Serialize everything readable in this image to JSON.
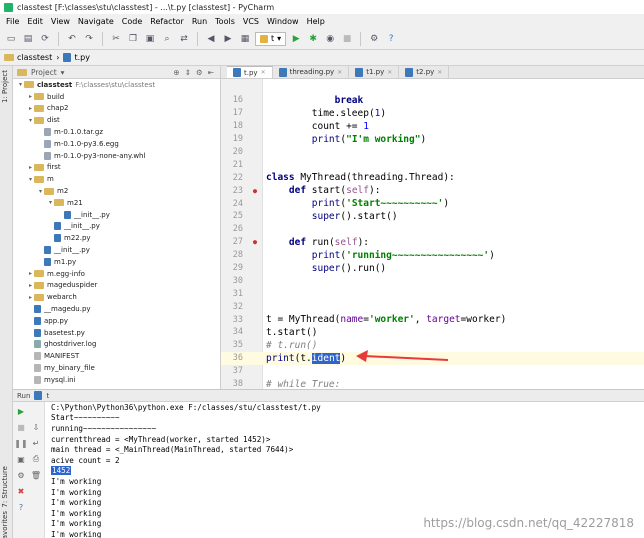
{
  "window": {
    "title": "classtest [F:\\classes\\stu\\classtest] - ...\\t.py [classtest] - PyCharm"
  },
  "menu": [
    "File",
    "Edit",
    "View",
    "Navigate",
    "Code",
    "Refactor",
    "Run",
    "Tools",
    "VCS",
    "Window",
    "Help"
  ],
  "toolbar": {
    "run_config": "t"
  },
  "breadcrumb": {
    "project": "classtest",
    "file": "t.py"
  },
  "project_panel": {
    "title": "Project",
    "root": {
      "name": "classtest",
      "path": "F:\\classes\\stu\\classtest"
    },
    "items": [
      {
        "label": "build",
        "type": "folder",
        "depth": 1,
        "arrow": "▸"
      },
      {
        "label": "chap2",
        "type": "folder",
        "depth": 1,
        "arrow": "▸"
      },
      {
        "label": "dist",
        "type": "folder",
        "depth": 1,
        "arrow": "▾"
      },
      {
        "label": "m-0.1.0.tar.gz",
        "type": "file",
        "depth": 2,
        "arrow": ""
      },
      {
        "label": "m-0.1.0-py3.6.egg",
        "type": "file",
        "depth": 2,
        "arrow": ""
      },
      {
        "label": "m-0.1.0-py3-none-any.whl",
        "type": "file",
        "depth": 2,
        "arrow": ""
      },
      {
        "label": "first",
        "type": "folder",
        "depth": 1,
        "arrow": "▸"
      },
      {
        "label": "m",
        "type": "folder",
        "depth": 1,
        "arrow": "▾"
      },
      {
        "label": "m2",
        "type": "folder",
        "depth": 2,
        "arrow": "▾"
      },
      {
        "label": "m21",
        "type": "folder",
        "depth": 3,
        "arrow": "▾"
      },
      {
        "label": "__init__.py",
        "type": "py",
        "depth": 4,
        "arrow": ""
      },
      {
        "label": "__init__.py",
        "type": "py",
        "depth": 3,
        "arrow": ""
      },
      {
        "label": "m22.py",
        "type": "py",
        "depth": 3,
        "arrow": ""
      },
      {
        "label": "__init__.py",
        "type": "py",
        "depth": 2,
        "arrow": ""
      },
      {
        "label": "m1.py",
        "type": "py",
        "depth": 2,
        "arrow": ""
      },
      {
        "label": "m.egg-info",
        "type": "folder",
        "depth": 1,
        "arrow": "▸"
      },
      {
        "label": "mageduspider",
        "type": "folder",
        "depth": 1,
        "arrow": "▸"
      },
      {
        "label": "webarch",
        "type": "folder",
        "depth": 1,
        "arrow": "▸"
      },
      {
        "label": "__magedu.py",
        "type": "py",
        "depth": 1,
        "arrow": ""
      },
      {
        "label": "app.py",
        "type": "py",
        "depth": 1,
        "arrow": ""
      },
      {
        "label": "basetest.py",
        "type": "py",
        "depth": 1,
        "arrow": ""
      },
      {
        "label": "ghostdriver.log",
        "type": "log",
        "depth": 1,
        "arrow": ""
      },
      {
        "label": "MANIFEST",
        "type": "txt",
        "depth": 1,
        "arrow": ""
      },
      {
        "label": "my_binary_file",
        "type": "txt",
        "depth": 1,
        "arrow": ""
      },
      {
        "label": "mysql.ini",
        "type": "txt",
        "depth": 1,
        "arrow": ""
      }
    ]
  },
  "tabs": [
    {
      "label": "t.py",
      "active": true
    },
    {
      "label": "threading.py",
      "active": false
    },
    {
      "label": "t1.py",
      "active": false
    },
    {
      "label": "t2.py",
      "active": false
    }
  ],
  "editor": {
    "lines": [
      {
        "n": "16",
        "text": "            break"
      },
      {
        "n": "17",
        "text": "        time.sleep(1)"
      },
      {
        "n": "18",
        "text": "        count += 1"
      },
      {
        "n": "19",
        "text": "        print(\"I'm working\")"
      },
      {
        "n": "20",
        "text": ""
      },
      {
        "n": "21",
        "text": ""
      },
      {
        "n": "22",
        "text": "class MyThread(threading.Thread):"
      },
      {
        "n": "23",
        "text": "    def start(self):"
      },
      {
        "n": "24",
        "text": "        print('Start~~~~~~~~~~')"
      },
      {
        "n": "25",
        "text": "        super().start()"
      },
      {
        "n": "26",
        "text": ""
      },
      {
        "n": "27",
        "text": "    def run(self):"
      },
      {
        "n": "28",
        "text": "        print('running~~~~~~~~~~~~~~~~')"
      },
      {
        "n": "29",
        "text": "        super().run()"
      },
      {
        "n": "30",
        "text": ""
      },
      {
        "n": "31",
        "text": ""
      },
      {
        "n": "32",
        "text": ""
      },
      {
        "n": "33",
        "text": "t = MyThread(name='worker', target=worker)"
      },
      {
        "n": "34",
        "text": "t.start()"
      },
      {
        "n": "35",
        "text": "# t.run()"
      },
      {
        "n": "36",
        "text": "print(t.ident)"
      },
      {
        "n": "37",
        "text": ""
      },
      {
        "n": "38",
        "text": "# while True:"
      }
    ]
  },
  "run_panel": {
    "title": "Run",
    "config": "t",
    "console": [
      "C:\\Python\\Python36\\python.exe F:/classes/stu/classtest/t.py",
      "Start~~~~~~~~~~",
      "running~~~~~~~~~~~~~~~~",
      "currentthread = <MyThread(worker, started 1452)>",
      "main thread = <_MainThread(MainThread, started 7644)>",
      "acive count = 2",
      "1452",
      "I'm working",
      "I'm working",
      "I'm working",
      "I'm working",
      "I'm working",
      "I'm working"
    ]
  },
  "side_tabs": {
    "project": "1: Project",
    "structure": "7: Structure",
    "favorites": "Favorites"
  },
  "watermark": "https://blog.csdn.net/qq_42227818",
  "colors": {
    "selection": "#2f65ca",
    "annotation_arrow": "#e83a3a",
    "current_line": "#fffbe0"
  }
}
